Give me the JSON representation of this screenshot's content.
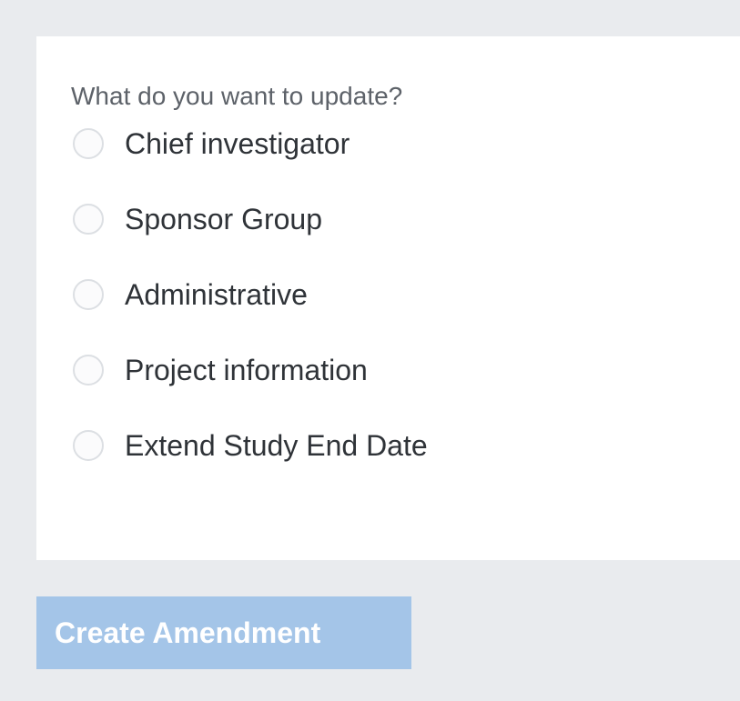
{
  "form": {
    "question": "What do you want to update?",
    "options": [
      {
        "label": "Chief investigator",
        "selected": false
      },
      {
        "label": "Sponsor Group",
        "selected": false
      },
      {
        "label": "Administrative",
        "selected": false
      },
      {
        "label": "Project information",
        "selected": false
      },
      {
        "label": "Extend Study End Date",
        "selected": false
      }
    ],
    "submit_label": "Create Amendment"
  }
}
